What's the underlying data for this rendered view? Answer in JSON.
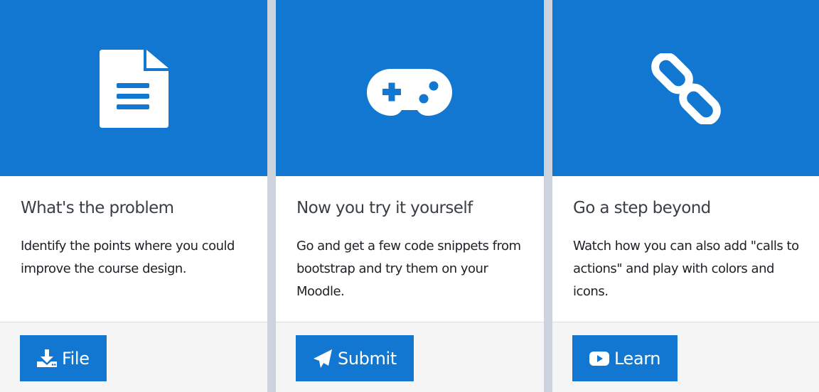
{
  "colors": {
    "primary": "#1177d1",
    "divider": "#cdd3dc",
    "footer_bg": "#f5f5f5",
    "title_text": "#3a3f45",
    "body_text": "#1d2125"
  },
  "cards": [
    {
      "hero_icon": "file-document-icon",
      "title": "What's the problem",
      "text": "Identify the points where you could improve the course design.",
      "button": {
        "icon": "download-icon",
        "label": "File"
      }
    },
    {
      "hero_icon": "gamepad-icon",
      "title": "Now you try it yourself",
      "text": "Go and get a few code snippets from bootstrap and try them on your Moodle.",
      "button": {
        "icon": "paper-plane-icon",
        "label": "Submit"
      }
    },
    {
      "hero_icon": "link-chain-icon",
      "title": "Go a step beyond",
      "text": "Watch how you can also add \"calls to actions\" and play with colors and icons.",
      "button": {
        "icon": "youtube-play-icon",
        "label": "Learn"
      }
    }
  ]
}
